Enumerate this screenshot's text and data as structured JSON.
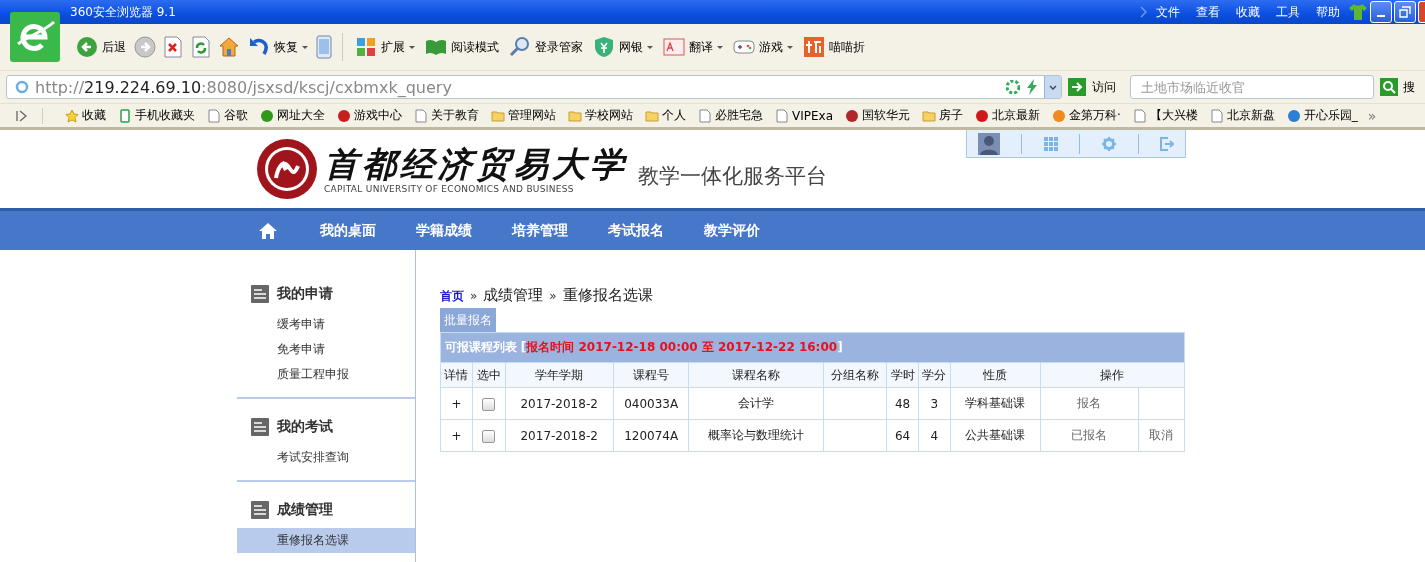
{
  "browser": {
    "title": "360安全浏览器 9.1",
    "menu": [
      "文件",
      "查看",
      "收藏",
      "工具",
      "帮助"
    ],
    "toolbar": [
      {
        "label": "后退",
        "dropdown": false
      },
      {
        "label": "恢复",
        "dropdown": true
      },
      {
        "label": "扩展",
        "dropdown": true
      },
      {
        "label": "阅读模式",
        "dropdown": false
      },
      {
        "label": "登录管家",
        "dropdown": false
      },
      {
        "label": "网银",
        "dropdown": true
      },
      {
        "label": "翻译",
        "dropdown": true
      },
      {
        "label": "游戏",
        "dropdown": true
      },
      {
        "label": "喵喵折",
        "dropdown": false
      }
    ],
    "address": {
      "scheme": "http://",
      "host": "219.224.69.10",
      "path": ":8080/jsxsd/kscj/cxbmxk_query"
    },
    "visit": "访问",
    "search_placeholder": "土地市场临近收官",
    "search_button": "搜",
    "bookmarks": [
      {
        "label": "收藏",
        "kind": "star"
      },
      {
        "label": "手机收藏夹",
        "kind": "phone"
      },
      {
        "label": "谷歌",
        "kind": "page"
      },
      {
        "label": "网址大全",
        "kind": "site",
        "color": "#2f9a1a"
      },
      {
        "label": "游戏中心",
        "kind": "site",
        "color": "#c81e1e"
      },
      {
        "label": "关于教育",
        "kind": "page"
      },
      {
        "label": "管理网站",
        "kind": "folder"
      },
      {
        "label": "学校网站",
        "kind": "folder"
      },
      {
        "label": "个人",
        "kind": "folder"
      },
      {
        "label": "必胜宅急",
        "kind": "page"
      },
      {
        "label": "VIPExa",
        "kind": "page"
      },
      {
        "label": "国软华元",
        "kind": "site",
        "color": "#b0272c"
      },
      {
        "label": "房子",
        "kind": "folder"
      },
      {
        "label": "北京最新",
        "kind": "site",
        "color": "#d01818"
      },
      {
        "label": "金第万科·",
        "kind": "site",
        "color": "#f08a1c"
      },
      {
        "label": "【大兴楼",
        "kind": "page"
      },
      {
        "label": "北京新盘",
        "kind": "page"
      },
      {
        "label": "开心乐园_",
        "kind": "site",
        "color": "#2c7fd4"
      }
    ],
    "more": "»"
  },
  "header": {
    "name": "首都经济贸易大学",
    "english": "CAPITAL UNIVERSITY OF ECONOMICS AND BUSINESS",
    "platform": "教学一体化服务平台"
  },
  "nav": [
    "我的桌面",
    "学籍成绩",
    "培养管理",
    "考试报名",
    "教学评价"
  ],
  "sidebar": {
    "sections": [
      {
        "title": "我的申请",
        "items": [
          {
            "label": "缓考申请",
            "selected": false
          },
          {
            "label": "免考申请",
            "selected": false
          },
          {
            "label": "质量工程申报",
            "selected": false
          }
        ]
      },
      {
        "title": "我的考试",
        "items": [
          {
            "label": "考试安排查询",
            "selected": false
          }
        ]
      },
      {
        "title": "成绩管理",
        "items": [
          {
            "label": "重修报名选课",
            "selected": true
          }
        ]
      }
    ]
  },
  "breadcrumb": [
    {
      "label": "首页",
      "kind": "link"
    },
    {
      "label": "»",
      "kind": "sep"
    },
    {
      "label": "成绩管理",
      "kind": "text"
    },
    {
      "label": "»",
      "kind": "sep"
    },
    {
      "label": "重修报名选课",
      "kind": "text"
    }
  ],
  "batch_button": "批量报名",
  "table": {
    "caption": "可报课程列表",
    "period_open": "[",
    "period": "报名时间 2017-12-18 00:00 至 2017-12-22 16:00",
    "period_close": "]",
    "columns": [
      "详情",
      "选中",
      "学年学期",
      "课程号",
      "课程名称",
      "分组名称",
      "学时",
      "学分",
      "性质",
      "操作"
    ],
    "rows": [
      {
        "detail": "+",
        "checked": false,
        "term": "2017-2018-2",
        "code": "040033A",
        "name": "会计学",
        "hours": "48",
        "credits": "3",
        "type": "学科基础课",
        "actions": [
          "报名"
        ]
      },
      {
        "detail": "+",
        "checked": false,
        "term": "2017-2018-2",
        "code": "120074A",
        "name": "概率论与数理统计",
        "hours": "64",
        "credits": "4",
        "type": "公共基础课",
        "actions": [
          "已报名",
          "取消"
        ]
      }
    ]
  }
}
